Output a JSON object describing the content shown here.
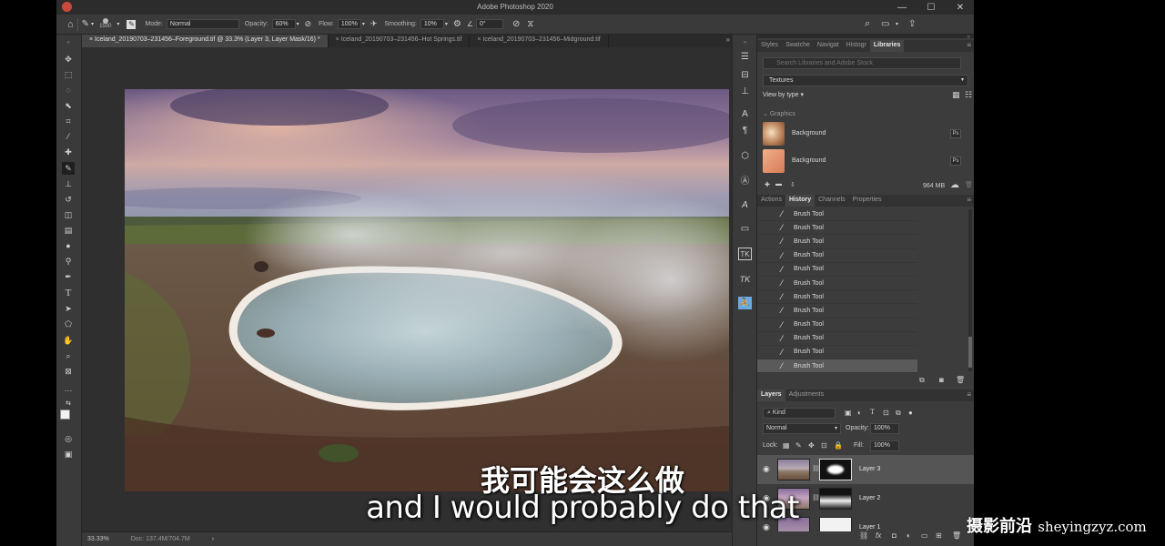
{
  "app": {
    "title": "Adobe Photoshop 2020",
    "window_controls": [
      "—",
      "☐",
      "✕"
    ]
  },
  "options_bar": {
    "brush_size": "1500",
    "mode_label": "Mode:",
    "mode_value": "Normal",
    "opacity_label": "Opacity:",
    "opacity_value": "60%",
    "flow_label": "Flow:",
    "flow_value": "100%",
    "smoothing_label": "Smoothing:",
    "smoothing_value": "10%",
    "angle_value": "0°"
  },
  "tabs": [
    {
      "label": "Iceland_20190703–231456–Foreground.tif @ 33.3% (Layer 3, Layer Mask/16) *",
      "close": "×",
      "active": true
    },
    {
      "label": "Iceland_20190703–231456–Hot Springs.tif",
      "close": "×",
      "active": false
    },
    {
      "label": "Iceland_20190703–231456–Midground.tif",
      "close": "×",
      "active": false
    }
  ],
  "tabs_more": "»",
  "status": {
    "zoom": "33.33%",
    "doc": "Doc: 137.4M/704.7M",
    "arrow": "›"
  },
  "libraries_panel": {
    "tabs": [
      "Styles",
      "Swatche",
      "Navigat",
      "Histogr",
      "Libraries"
    ],
    "search_placeholder": "Search Libraries and Adobe Stock",
    "library_name": "Textures",
    "view_by": "View by type",
    "section": "Graphics",
    "items": [
      {
        "name": "Background",
        "badge": "Ps"
      },
      {
        "name": "Background",
        "badge": "Ps"
      }
    ],
    "storage": "964 MB"
  },
  "history_panel": {
    "tabs": [
      "Actions",
      "History",
      "Channels",
      "Properties"
    ],
    "items": [
      "Brush Tool",
      "Brush Tool",
      "Brush Tool",
      "Brush Tool",
      "Brush Tool",
      "Brush Tool",
      "Brush Tool",
      "Brush Tool",
      "Brush Tool",
      "Brush Tool",
      "Brush Tool",
      "Brush Tool"
    ],
    "selected_index": 11
  },
  "layers_panel": {
    "tabs": [
      "Layers",
      "Adjustments"
    ],
    "filter_label": "Kind",
    "blend_mode": "Normal",
    "opacity_label": "Opacity:",
    "opacity_value": "100%",
    "lock_label": "Lock:",
    "fill_label": "Fill:",
    "fill_value": "100%",
    "layers": [
      {
        "name": "Layer 3",
        "selected": true
      },
      {
        "name": "Layer 2",
        "selected": false
      },
      {
        "name": "Layer 1",
        "selected": false
      }
    ]
  },
  "subtitles": {
    "chinese": "我可能会这么做",
    "english": "and I would probably do that"
  },
  "watermark": {
    "cn": "摄影前沿",
    "en": "sheyingzyz.com"
  },
  "colors": {
    "panel_bg": "#3c3c3c",
    "canvas_bg": "#2f2f2f",
    "selected_row": "#5a5a5a"
  }
}
